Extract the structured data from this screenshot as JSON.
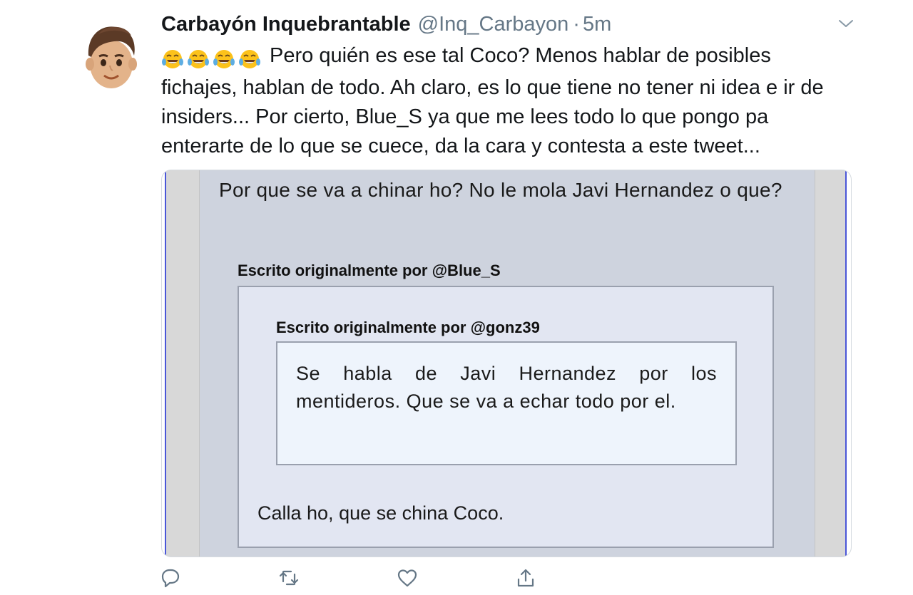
{
  "tweet": {
    "display_name": "Carbayón Inquebrantable",
    "handle": "@Inq_Carbayon",
    "separator": "·",
    "timestamp": "5m",
    "emoji_icons": [
      "tears-of-joy-emoji",
      "tears-of-joy-emoji",
      "tears-of-joy-emoji",
      "tears-of-joy-emoji"
    ],
    "text": "Pero quién es ese tal Coco? Menos hablar de posibles fichajes, hablan de todo. Ah claro, es lo que tiene no tener ni idea e ir de insiders... Por cierto, Blue_S ya que me lees todo lo que pongo pa enterarte de lo que se cuece, da la cara y contesta a este tweet..."
  },
  "media": {
    "post_text": "Por que se va a chinar ho? No le mola Javi Hernandez o que?",
    "quote_outer": {
      "label": "Escrito originalmente por @Blue_S",
      "reply": "Calla ho, que se china Coco."
    },
    "quote_inner": {
      "label": "Escrito originalmente por @gonz39",
      "text": "Se habla de Javi Hernandez por los mentideros. Que se va a echar todo por el."
    }
  },
  "actions": {
    "icons": [
      "reply-icon",
      "retweet-icon",
      "like-icon",
      "share-icon"
    ]
  },
  "colors": {
    "handle_gray": "#657786",
    "media_bg": "#ced3de",
    "quote_outer_bg": "#e2e6f2",
    "quote_inner_bg": "#eef4fc",
    "accent_line": "#4a56d8"
  }
}
